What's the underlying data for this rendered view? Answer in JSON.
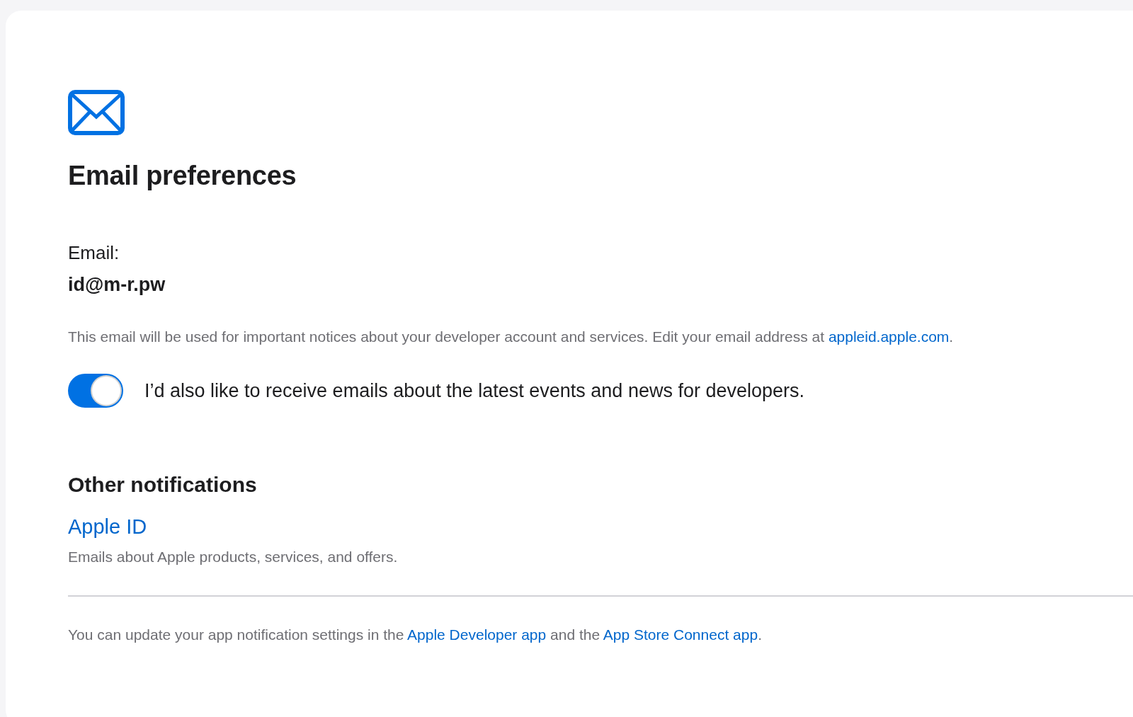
{
  "title": "Email preferences",
  "email": {
    "label": "Email:",
    "value": "id@m-r.pw"
  },
  "notice": [
    {
      "kind": "text",
      "text": "This email will be used for important notices about your developer account and services. Edit your email address at "
    },
    {
      "kind": "link",
      "text": "appleid.apple.com"
    },
    {
      "kind": "text",
      "text": "."
    }
  ],
  "toggle": {
    "on": true,
    "label": "I’d also like to receive emails about the latest events and news for developers."
  },
  "other": {
    "heading": "Other notifications",
    "link": "Apple ID",
    "description": "Emails about Apple products, services, and offers."
  },
  "footer": [
    {
      "kind": "text",
      "text": "You can update your app notification settings in the "
    },
    {
      "kind": "link",
      "text": "Apple Developer app"
    },
    {
      "kind": "text",
      "text": " and the "
    },
    {
      "kind": "link",
      "text": "App Store Connect app"
    },
    {
      "kind": "text",
      "text": "."
    }
  ]
}
